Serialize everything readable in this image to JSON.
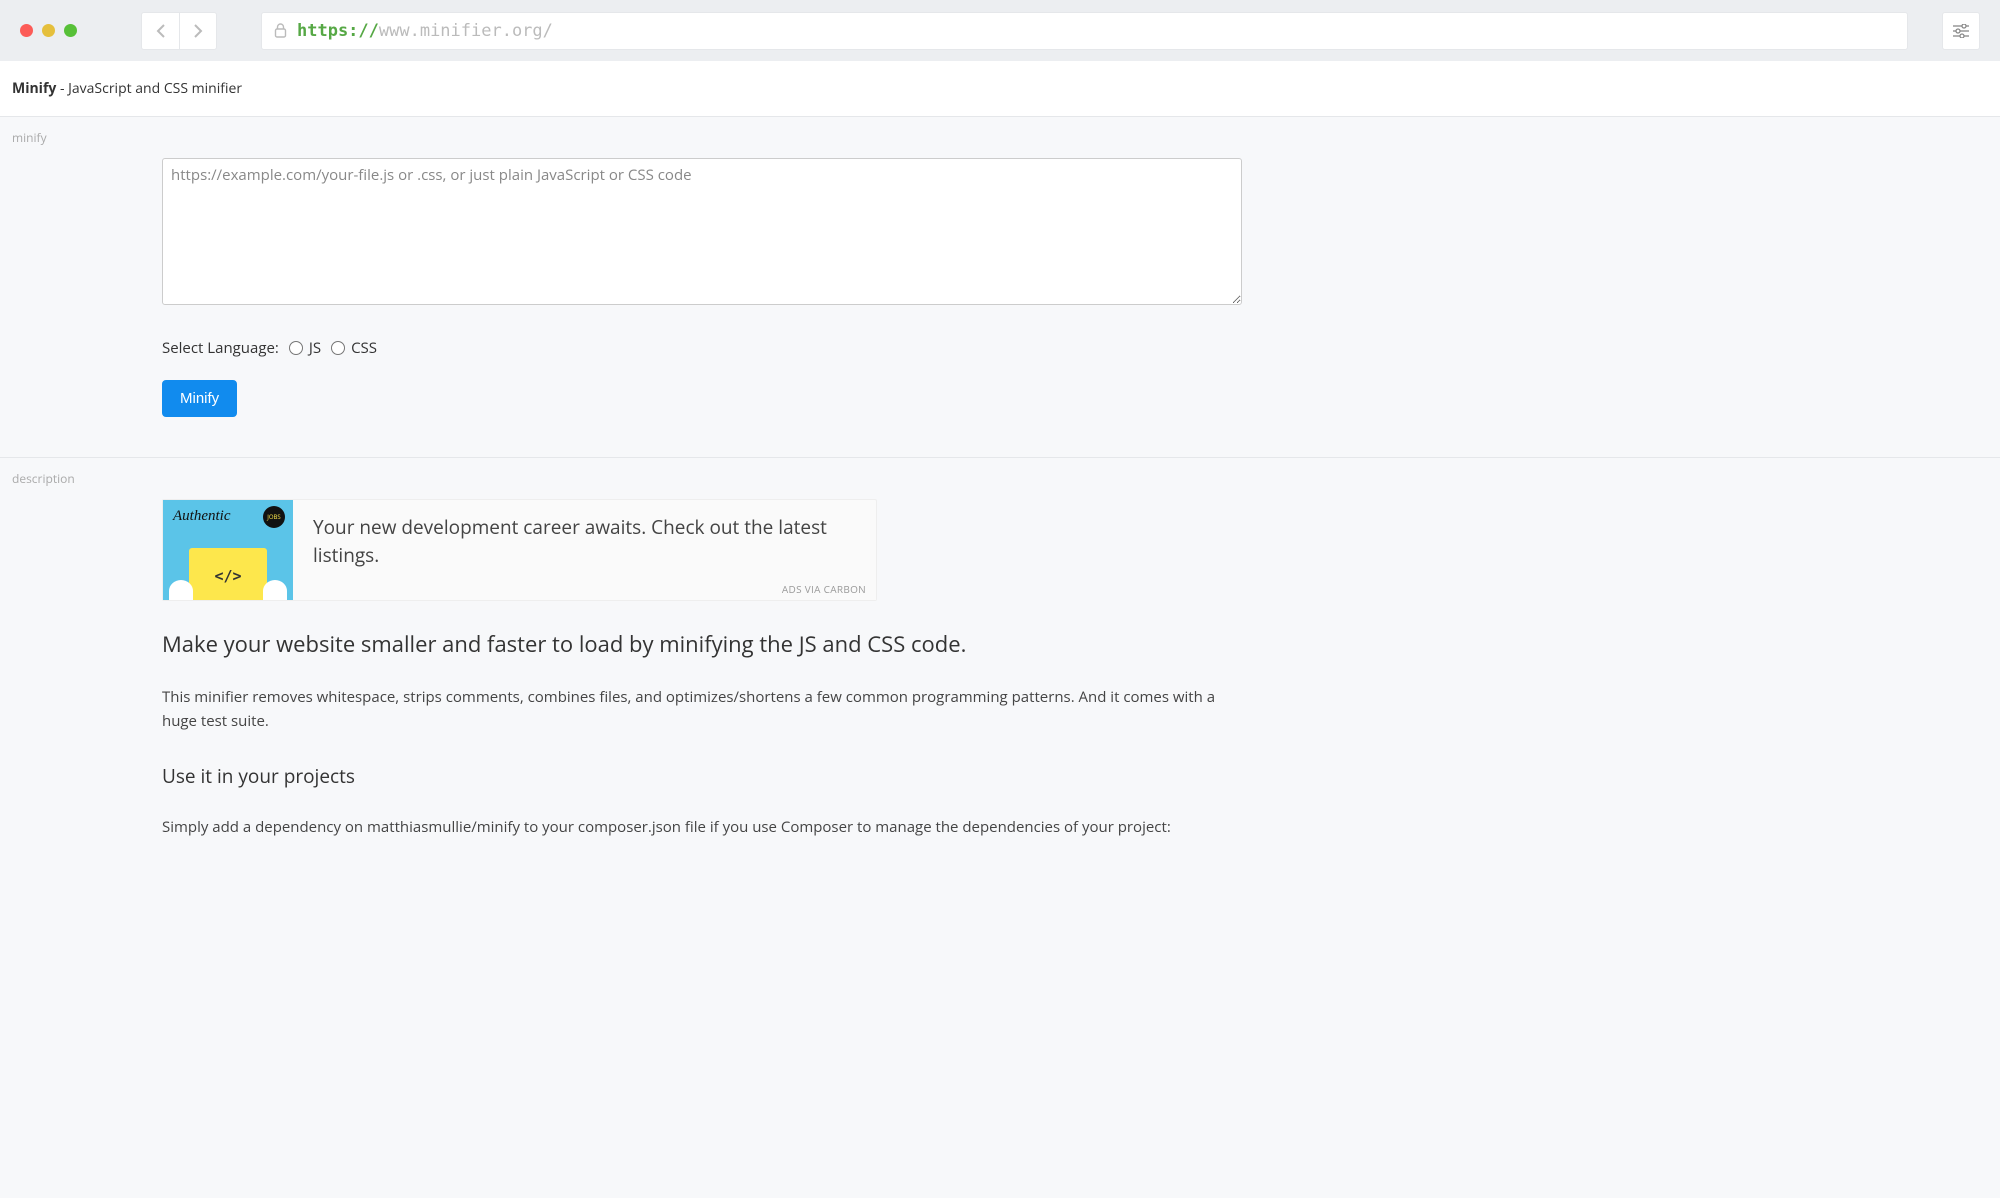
{
  "browser": {
    "url_protocol": "https://",
    "url_host": "www.minifier.org/"
  },
  "header": {
    "brand": "Minify",
    "tagline": " - JavaScript and CSS minifier"
  },
  "minify_section": {
    "label": "minify",
    "textarea_placeholder": "https://example.com/your-file.js or .css, or just plain JavaScript or CSS code",
    "select_language_label": "Select Language:",
    "lang_js": "JS",
    "lang_css": "CSS",
    "button_label": "Minify"
  },
  "description_section": {
    "label": "description",
    "ad": {
      "brand_script": "Authentic",
      "badge": "JOBS",
      "code_glyph": "</>",
      "text": "Your new development career awaits. Check out the latest listings.",
      "via": "ADS VIA CARBON"
    },
    "lead": "Make your website smaller and faster to load by minifying the JS and CSS code.",
    "paragraph": "This minifier removes whitespace, strips comments, combines files, and optimizes/shortens a few common programming patterns. And it comes with a huge test suite.",
    "subheading": "Use it in your projects",
    "paragraph2": "Simply add a dependency on matthiasmullie/minify to your composer.json file if you use Composer to manage the dependencies of your project:"
  }
}
